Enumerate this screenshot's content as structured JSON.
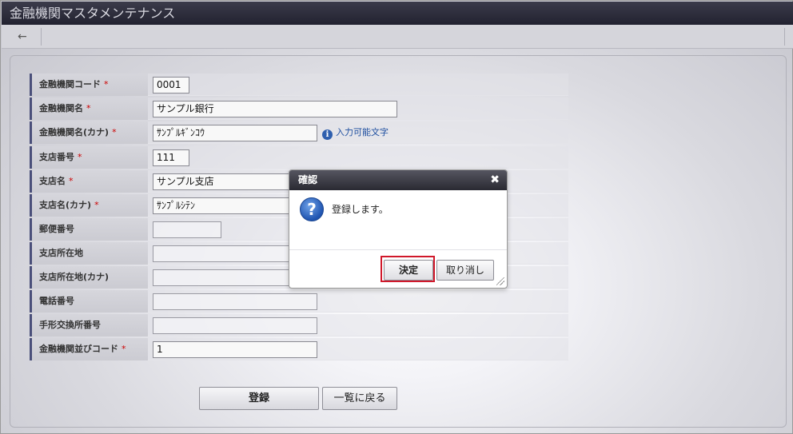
{
  "window": {
    "title": "金融機関マスタメンテナンス"
  },
  "toolbar": {
    "back_glyph": "←"
  },
  "form": {
    "required_mark": "*",
    "rows": [
      {
        "label": "金融機関コード",
        "required": true,
        "value": "0001"
      },
      {
        "label": "金融機関名",
        "required": true,
        "value": "サンプル銀行"
      },
      {
        "label": "金融機関名(カナ)",
        "required": true,
        "value": "ｻﾝﾌﾟﾙｷﾞﾝｺｳ",
        "hint": "入力可能文字"
      },
      {
        "label": "支店番号",
        "required": true,
        "value": "111"
      },
      {
        "label": "支店名",
        "required": true,
        "value": "サンプル支店"
      },
      {
        "label": "支店名(カナ)",
        "required": true,
        "value": "ｻﾝﾌﾟﾙｼﾃﾝ"
      },
      {
        "label": "郵便番号",
        "required": false,
        "value": ""
      },
      {
        "label": "支店所在地",
        "required": false,
        "value": ""
      },
      {
        "label": "支店所在地(カナ)",
        "required": false,
        "value": ""
      },
      {
        "label": "電話番号",
        "required": false,
        "value": ""
      },
      {
        "label": "手形交換所番号",
        "required": false,
        "value": ""
      },
      {
        "label": "金融機関並びコード",
        "required": true,
        "value": "1"
      }
    ]
  },
  "actions": {
    "register_label": "登録",
    "back_to_list_label": "一覧に戻る"
  },
  "dialog": {
    "title": "確認",
    "close_glyph": "✖",
    "message": "登録します。",
    "ok_label": "決定",
    "cancel_label": "取り消し",
    "question_glyph": "?"
  },
  "colors": {
    "highlight": "#d0182a",
    "required": "#cc0000",
    "hint_link": "#1f4fa0"
  }
}
